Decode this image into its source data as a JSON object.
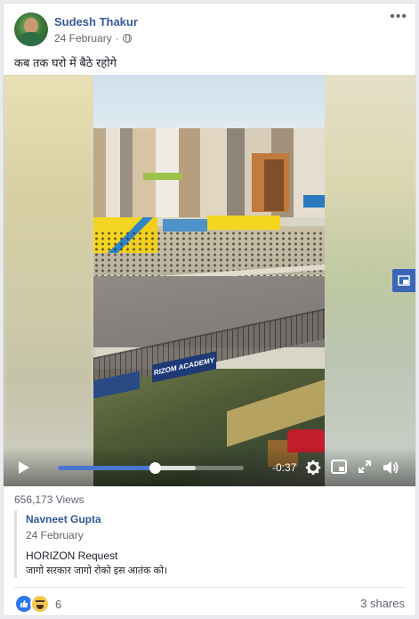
{
  "post": {
    "author": "Sudesh Thakur",
    "date": "24 February",
    "separator": "·",
    "caption": "कब तक घरो में बैठे रहोगे",
    "more_icon": "more-horizontal-icon",
    "privacy_icon": "globe-icon"
  },
  "video": {
    "time_remaining": "-0:37",
    "played_fraction": 0.52,
    "buffered_fraction": 0.74,
    "icons": [
      "play-icon",
      "settings-gear-icon",
      "picture-in-picture-icon",
      "fullscreen-icon",
      "volume-icon",
      "popout-icon"
    ],
    "scene_sign_text": "RIZOM ACADEMY"
  },
  "stats": {
    "views": "656,173 Views",
    "reaction_count": "6",
    "shares": "3 shares",
    "reactions": [
      "like",
      "haha"
    ]
  },
  "shared_from": {
    "author": "Navneet Gupta",
    "date": "24 February",
    "line1": "HORIZON Request",
    "line2": "जागो सरकार जागो रोको इस आतंक को।"
  },
  "colors": {
    "link_blue": "#365899",
    "progress_blue": "#4a76cf",
    "like_blue": "#2e77f2"
  }
}
